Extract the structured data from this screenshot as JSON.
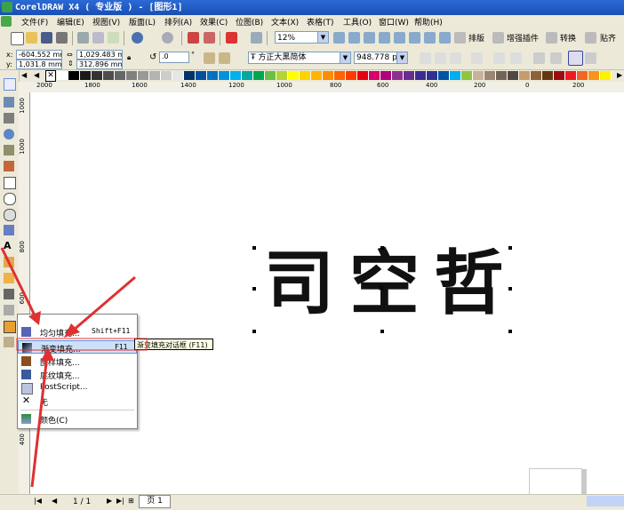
{
  "window": {
    "title": "CorelDRAW X4 ( 专业版 ) - [图形1]"
  },
  "menubar": {
    "items": [
      "文件(F)",
      "编辑(E)",
      "视图(V)",
      "版面(L)",
      "排列(A)",
      "效果(C)",
      "位图(B)",
      "文本(X)",
      "表格(T)",
      "工具(O)",
      "窗口(W)",
      "帮助(H)"
    ]
  },
  "toolbar": {
    "zoom": "12%",
    "buttons": [
      "排版",
      "增强插件",
      "转换",
      "贴齐"
    ]
  },
  "propbar": {
    "x_label": "x:",
    "x_value": "-604.552 mm",
    "y_label": "y:",
    "y_value": "1,031.8 mm",
    "w_value": "1,029.483 mm",
    "h_value": "312.896 mm",
    "rotation": ".0",
    "rotation_unit": "°",
    "font_name": "方正大黑简体",
    "font_size": "948.778 pt"
  },
  "ruler": {
    "h_ticks": [
      "2000",
      "1800",
      "1600",
      "1400",
      "1200",
      "1000",
      "800",
      "600",
      "400",
      "200",
      "0",
      "200"
    ],
    "v_ticks": [
      "1000",
      "1000",
      "800",
      "600",
      "400"
    ],
    "unit": "毫米"
  },
  "canvas": {
    "text_chars": [
      "司",
      "空",
      "哲"
    ]
  },
  "context_menu": {
    "items": [
      {
        "label": "均匀填充...",
        "shortcut": "Shift+F11",
        "icon": "uniform-fill-icon",
        "highlighted": false
      },
      {
        "label": "渐变填充...",
        "shortcut": "F11",
        "icon": "gradient-fill-icon",
        "highlighted": true
      },
      {
        "label": "图样填充...",
        "shortcut": "",
        "icon": "pattern-fill-icon",
        "highlighted": false
      },
      {
        "label": "底纹填充...",
        "shortcut": "",
        "icon": "texture-fill-icon",
        "highlighted": false
      },
      {
        "label": "PostScript...",
        "shortcut": "",
        "icon": "postscript-fill-icon",
        "highlighted": false
      },
      {
        "label": "无",
        "shortcut": "",
        "icon": "no-fill-icon",
        "highlighted": false
      },
      {
        "label": "颜色(C)",
        "shortcut": "",
        "icon": "color-docker-icon",
        "highlighted": false
      }
    ]
  },
  "tooltip": {
    "text": "渐变填充对话框 (F11)"
  },
  "statusbar": {
    "page_indicator": "1 / 1",
    "page_tab": "页 1"
  },
  "colors": {
    "accent_arrow": "#e03030",
    "title_bar": "#1f5bc6",
    "menu_highlight": "#cde0f7",
    "palette": [
      "#ffffff",
      "#000000",
      "#1a1a1a",
      "#333333",
      "#4d4d4d",
      "#666666",
      "#808080",
      "#999999",
      "#b3b3b3",
      "#cccccc",
      "#e6e6e6",
      "#003366",
      "#00509e",
      "#0070c0",
      "#0093dd",
      "#00b0f0",
      "#00a89d",
      "#00a650",
      "#6dbe45",
      "#b5d334",
      "#ffff00",
      "#ffd200",
      "#ffb400",
      "#ff8c00",
      "#ff6400",
      "#ff3c00",
      "#e60012",
      "#d7006c",
      "#b0007c",
      "#8e2f8e",
      "#6a2c8f",
      "#3d2c8f",
      "#2e3192",
      "#0054a6",
      "#00aeef",
      "#8dc63f",
      "#c7b299",
      "#998675",
      "#736357",
      "#534741",
      "#c69c6d",
      "#8c6239",
      "#603913",
      "#9e0b0f",
      "#ed1c24",
      "#f26522",
      "#f7941d",
      "#fff200"
    ]
  }
}
